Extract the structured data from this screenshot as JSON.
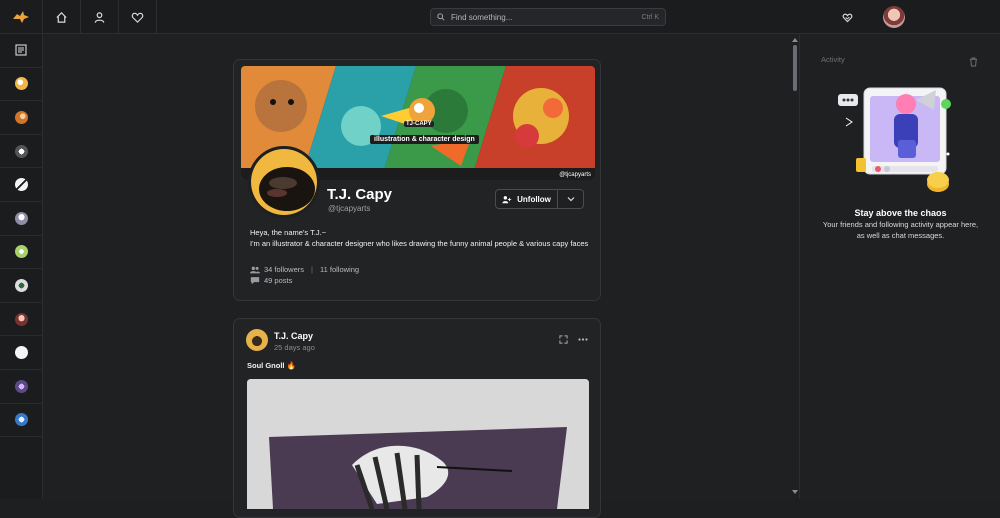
{
  "topbar": {
    "search_placeholder": "Find something...",
    "search_shortcut": "Ctrl K",
    "nav": [
      "home-icon",
      "user-icon",
      "heart-icon"
    ]
  },
  "rail": {
    "items": [
      {
        "icon": "feed-icon",
        "color": "#d9d9d9"
      },
      {
        "icon": "community-icon",
        "color": "#f0b64a"
      },
      {
        "icon": "community-icon",
        "color": "#d2752a"
      },
      {
        "icon": "community-icon",
        "color": "#c8c8c8"
      },
      {
        "icon": "community-icon",
        "color": "#f3f3f3"
      },
      {
        "icon": "community-icon",
        "color": "#c9c9d6"
      },
      {
        "icon": "community-icon",
        "color": "#a8d16b"
      },
      {
        "icon": "community-icon",
        "color": "#dcdcdc"
      },
      {
        "icon": "community-icon",
        "color": "#c8716a"
      },
      {
        "icon": "community-icon",
        "color": "#f5f5f5"
      },
      {
        "icon": "community-icon",
        "color": "#9b7fd6"
      },
      {
        "icon": "community-icon",
        "color": "#5fa3e8"
      }
    ]
  },
  "profile": {
    "name": "T.J. Capy",
    "handle": "@tjcapyarts",
    "unfollow_label": "Unfollow",
    "bio_line1": "Heya, the name's T.J.~",
    "bio_line2": "I'm an illustrator & character designer who likes drawing the funny animal people & various capy faces",
    "followers": "34 followers",
    "following": "11 following",
    "posts": "49 posts",
    "banner": {
      "logo_text": "TJ-CAPY",
      "title": "illustration & character design",
      "handle": "@tjcapyarts"
    }
  },
  "post": {
    "author": "T.J. Capy",
    "time": "25 days ago",
    "text": "Soul Gnoll 🔥"
  },
  "activity": {
    "title": "Activity",
    "heading": "Stay above the chaos",
    "subtext": "Your friends and following activity appear here, as well as chat messages."
  },
  "colors": {
    "accent": "#f0a23b",
    "background": "#1f2022",
    "card": "#222325"
  }
}
